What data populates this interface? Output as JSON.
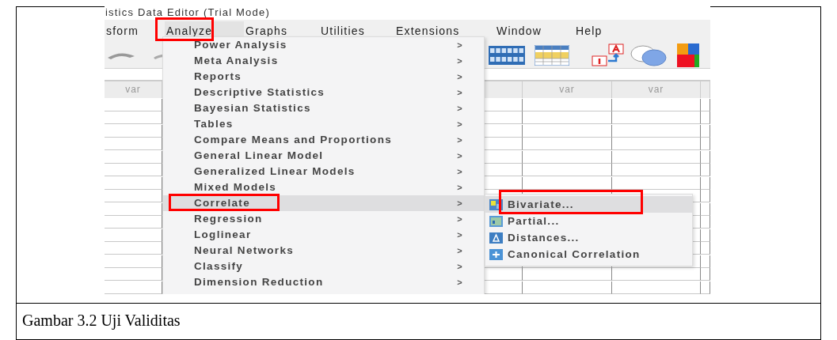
{
  "window": {
    "title": "istics Data Editor (Trial Mode)"
  },
  "menubar": [
    {
      "label": "sform",
      "selected": false,
      "annotated": false
    },
    {
      "label": "Analyze",
      "selected": true,
      "annotated": true
    },
    {
      "label": "Graphs",
      "selected": false,
      "annotated": false
    },
    {
      "label": "Utilities",
      "selected": false,
      "annotated": false
    },
    {
      "label": "Extensions",
      "selected": false,
      "annotated": false
    },
    {
      "label": "Window",
      "selected": false,
      "annotated": false
    },
    {
      "label": "Help",
      "selected": false,
      "annotated": false
    }
  ],
  "grid": {
    "columns": [
      {
        "header": "var"
      },
      {
        "header": "var"
      },
      {
        "header": "var"
      }
    ]
  },
  "analyze_menu": [
    {
      "label": "Power Analysis",
      "selected": false,
      "annotated": false,
      "arrow": ">"
    },
    {
      "label": "Meta Analysis",
      "selected": false,
      "annotated": false,
      "arrow": ">"
    },
    {
      "label": "Reports",
      "selected": false,
      "annotated": false,
      "arrow": ">"
    },
    {
      "label": "Descriptive Statistics",
      "selected": false,
      "annotated": false,
      "arrow": ">"
    },
    {
      "label": "Bayesian Statistics",
      "selected": false,
      "annotated": false,
      "arrow": ">"
    },
    {
      "label": "Tables",
      "selected": false,
      "annotated": false,
      "arrow": ">"
    },
    {
      "label": "Compare Means and Proportions",
      "selected": false,
      "annotated": false,
      "arrow": ">"
    },
    {
      "label": "General Linear Model",
      "selected": false,
      "annotated": false,
      "arrow": ">"
    },
    {
      "label": "Generalized Linear Models",
      "selected": false,
      "annotated": false,
      "arrow": ">"
    },
    {
      "label": "Mixed Models",
      "selected": false,
      "annotated": false,
      "arrow": ">"
    },
    {
      "label": "Correlate",
      "selected": true,
      "annotated": true,
      "arrow": ">"
    },
    {
      "label": "Regression",
      "selected": false,
      "annotated": false,
      "arrow": ">"
    },
    {
      "label": "Loglinear",
      "selected": false,
      "annotated": false,
      "arrow": ">"
    },
    {
      "label": "Neural Networks",
      "selected": false,
      "annotated": false,
      "arrow": ">"
    },
    {
      "label": "Classify",
      "selected": false,
      "annotated": false,
      "arrow": ">"
    },
    {
      "label": "Dimension Reduction",
      "selected": false,
      "annotated": false,
      "arrow": ">"
    }
  ],
  "correlate_submenu": [
    {
      "label": "Bivariate...",
      "selected": true,
      "annotated": true,
      "kind": "bivariate"
    },
    {
      "label": "Partial...",
      "selected": false,
      "annotated": false,
      "kind": "partial"
    },
    {
      "label": "Distances...",
      "selected": false,
      "annotated": false,
      "kind": "distances"
    },
    {
      "label": "Canonical Correlation",
      "selected": false,
      "annotated": false,
      "kind": "canonical"
    }
  ],
  "caption": "Gambar 3.2 Uji Validitas"
}
